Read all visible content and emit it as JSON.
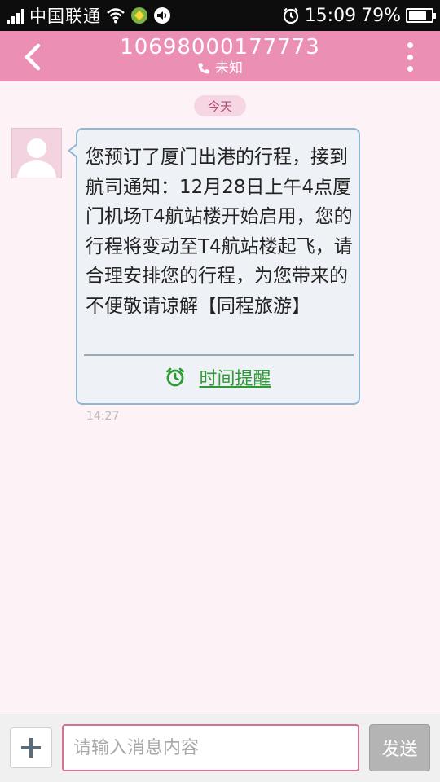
{
  "status_bar": {
    "carrier": "中国联通",
    "time": "15:09",
    "battery_percent_text": "79%",
    "battery_level": 0.79
  },
  "header": {
    "phone_number": "10698000177773",
    "contact_status": "未知"
  },
  "conversation": {
    "date_label": "今天",
    "messages": [
      {
        "text": "您预订了厦门出港的行程，接到航司通知：12月28日上午4点厦门机场T4航站楼开始启用，您的行程将变动至T4航站楼起飞，请合理安排您的行程，为您带来的不便敬请谅解【同程旅游】",
        "reminder_label": "时间提醒",
        "time": "14:27"
      }
    ]
  },
  "composer": {
    "placeholder": "请输入消息内容",
    "value": "",
    "send_label": "发送"
  },
  "colors": {
    "title_bar": "#ec8fb5",
    "background": "#fdf2f6",
    "bubble_border": "#8fb7d4",
    "reminder_green": "#2e9a35",
    "input_border": "#d86f98"
  },
  "icons": {
    "back": "back-arrow-icon",
    "more": "more-vertical-icon",
    "phone": "phone-icon",
    "alarm": "alarm-clock-icon",
    "add": "plus-icon",
    "wifi": "wifi-icon",
    "volume": "volume-icon",
    "alarm_status": "alarm-icon",
    "battery": "battery-icon"
  }
}
